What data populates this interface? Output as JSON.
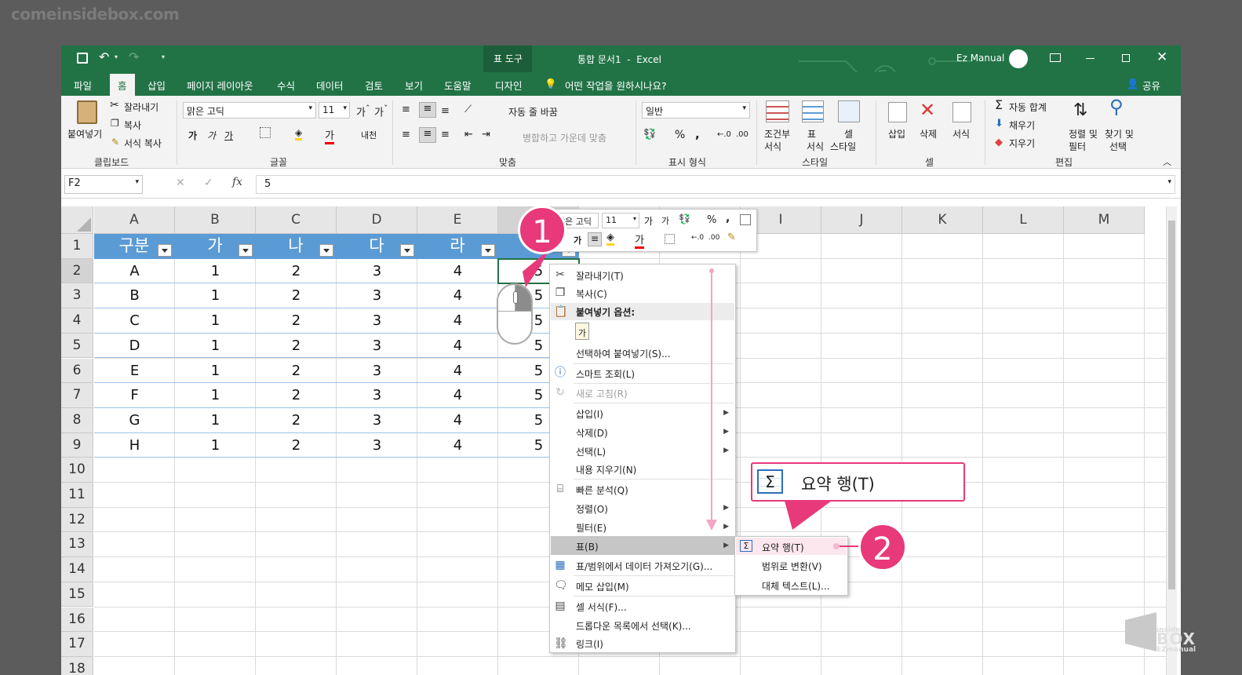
{
  "watermark": "comeinsidebox.com",
  "titlebar": {
    "table_tools": "표 도구",
    "title": "통합 문서1  -  Excel",
    "user": "Ez Manual"
  },
  "tabs": [
    "파일",
    "홈",
    "삽입",
    "페이지 레이아웃",
    "수식",
    "데이터",
    "검토",
    "보기",
    "도움말",
    "디자인"
  ],
  "tell_me": "어떤 작업을 원하시나요?",
  "share": "공유",
  "ribbon": {
    "clipboard": {
      "paste": "붙여넣기",
      "cut": "잘라내기",
      "copy": "복사",
      "format_painter": "서식 복사",
      "label": "클립보드"
    },
    "font": {
      "name": "맑은 고딕",
      "size": "11",
      "label": "글꼴"
    },
    "alignment": {
      "wrap": "자동 줄 바꿈",
      "merge": "병합하고 가운데 맞춤",
      "label": "맞춤"
    },
    "number": {
      "format": "일반",
      "label": "표시 형식"
    },
    "styles": {
      "conditional_1": "조건부",
      "conditional_2": "서식",
      "table_1": "표",
      "table_2": "서식",
      "cell_1": "셀",
      "cell_2": "스타일",
      "label": "스타일"
    },
    "cells": {
      "insert": "삽입",
      "delete": "삭제",
      "format": "서식",
      "label": "셀"
    },
    "editing": {
      "autosum": "자동 합계",
      "fill": "채우기",
      "clear": "지우기",
      "sort_1": "정렬 및",
      "sort_2": "필터",
      "find_1": "찾기 및",
      "find_2": "선택",
      "label": "편집"
    }
  },
  "formula_bar": {
    "name_box": "F2",
    "value": "5"
  },
  "columns": [
    "A",
    "B",
    "C",
    "D",
    "E",
    "F",
    "G",
    "H",
    "I",
    "J",
    "K",
    "L",
    "M"
  ],
  "rows": [
    "1",
    "2",
    "3",
    "4",
    "5",
    "6",
    "7",
    "8",
    "9",
    "10",
    "11",
    "12",
    "13",
    "14",
    "15",
    "16",
    "17",
    "18"
  ],
  "table": {
    "headers": [
      "구분",
      "가",
      "나",
      "다",
      "라"
    ],
    "data": [
      [
        "A",
        "1",
        "2",
        "3",
        "4",
        "5"
      ],
      [
        "B",
        "1",
        "2",
        "3",
        "4",
        "5"
      ],
      [
        "C",
        "1",
        "2",
        "3",
        "4",
        "5"
      ],
      [
        "D",
        "1",
        "2",
        "3",
        "4",
        "5"
      ],
      [
        "E",
        "1",
        "2",
        "3",
        "4",
        "5"
      ],
      [
        "F",
        "1",
        "2",
        "3",
        "4",
        "5"
      ],
      [
        "G",
        "1",
        "2",
        "3",
        "4",
        "5"
      ],
      [
        "H",
        "1",
        "2",
        "3",
        "4",
        "5"
      ]
    ]
  },
  "mini_toolbar": {
    "font": "맑은 고딕",
    "size": "11"
  },
  "context_menu": {
    "cut": "잘라내기(T)",
    "copy": "복사(C)",
    "paste_options": "붙여넣기 옵션:",
    "paste_special": "선택하여 붙여넣기(S)...",
    "smart_lookup": "스마트 조회(L)",
    "refresh": "새로 고침(R)",
    "insert": "삽입(I)",
    "delete": "삭제(D)",
    "select": "선택(L)",
    "clear": "내용 지우기(N)",
    "quick_analysis": "빠른 분석(Q)",
    "sort": "정렬(O)",
    "filter": "필터(E)",
    "table": "표(B)",
    "get_data": "표/범위에서 데이터 가져오기(G)...",
    "insert_comment": "메모 삽입(M)",
    "format_cells": "셀 서식(F)...",
    "pick_list": "드롭다운 목록에서 선택(K)...",
    "link": "링크(I)"
  },
  "submenu": {
    "total_row": "요약 행(T)",
    "convert": "범위로 변환(V)",
    "alt_text": "대체 텍스트(L)..."
  },
  "callout": {
    "text": "요약 행(T)"
  },
  "badges": {
    "one": "1",
    "two": "2"
  },
  "logo": {
    "line1": "inside",
    "line2": "BOX",
    "line3": "EZmanual"
  },
  "colors": {
    "excel_green": "#217346",
    "table_header": "#5b9bd5",
    "accent": "#e8397a"
  }
}
